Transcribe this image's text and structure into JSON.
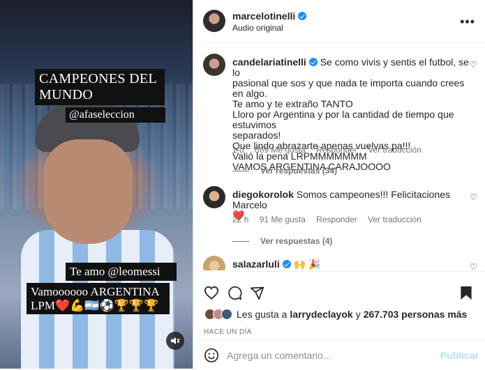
{
  "media": {
    "overlay_1": "CAMPEONES DEL MUNDO",
    "overlay_2": "@afaseleccion",
    "overlay_3": "Te amo @leomessi",
    "overlay_4": "Vamoooooo ARGENTINA LPM❤️💪🇦🇷⚽🏆🏆🏆",
    "sound_icon": "speaker-muted-icon"
  },
  "header": {
    "username": "marcelotinelli",
    "audio": "Audio original",
    "more_icon": "more-options-icon"
  },
  "comments": [
    {
      "username": "candelariatinelli",
      "lines": [
        "Se como vivis y sentis el futbol, se lo",
        "pasional que sos y que nada te importa cuando crees en algo.",
        "Te amo y te extraño TANTO",
        "Lloro por Argentina y por la cantidad de tiempo que estuvimos",
        "separados!",
        "Que lindo abrazarte apenas vuelvas pa!!!",
        "Valió la pena LRPMMMMMMM",
        "VAMOS ARGENTINA CARAJOOOO"
      ],
      "time": "1 d",
      "likes": "669 Me gusta",
      "reply": "Responder",
      "translate": "Ver traducción",
      "view_replies": "Ver respuestas (34)"
    },
    {
      "username": "diegokorolok",
      "lines": [
        "Somos campeones!!! Felicitaciones Marcelo",
        "❤️"
      ],
      "time": "22 h",
      "likes": "91 Me gusta",
      "reply": "Responder",
      "translate": "Ver traducción",
      "view_replies": "Ver respuestas (4)"
    },
    {
      "username": "salazarluli",
      "lines": [
        "🙌 🎉"
      ]
    }
  ],
  "footer": {
    "likes_text_prefix": "Les gusta a ",
    "likes_user": "larrydeclayok",
    "likes_text_mid": " y ",
    "likes_count": "267.703 personas más",
    "timestamp": "HACE UN DÍA",
    "add_comment_placeholder": "Agrega un comentario...",
    "publish": "Publicar"
  },
  "colors": {
    "verified": "#1a8cf5",
    "publish": "#b2dffc",
    "heart": "#ed4956"
  }
}
